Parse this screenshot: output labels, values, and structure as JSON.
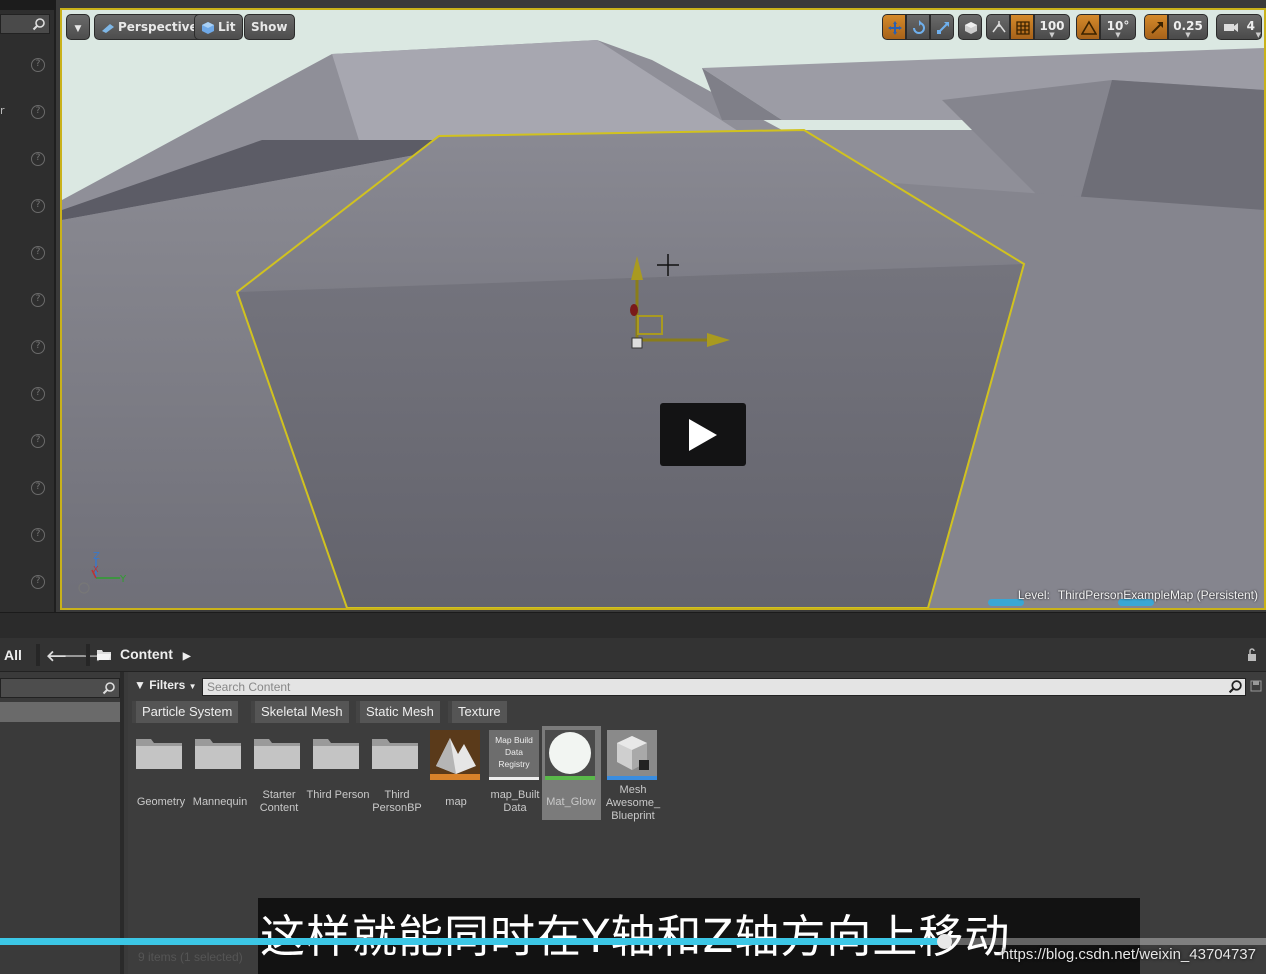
{
  "viewport": {
    "perspective_label": "Perspective",
    "lit_label": "Lit",
    "show_label": "Show",
    "grid_snap_value": "100",
    "rotation_snap_value": "10°",
    "scale_snap_value": "0.25",
    "camera_speed_value": "4",
    "level_prefix": "Level:",
    "level_name": "ThirdPersonExampleMap (Persistent)",
    "accent_selection": "#d1c21f",
    "accent_orange": "#c97b22"
  },
  "content_browser": {
    "all_label": "All",
    "path_label": "Content",
    "filters_label": "Filters",
    "search_placeholder": "Search Content",
    "filter_chips": [
      "Particle System",
      "Skeletal Mesh",
      "Static Mesh",
      "Texture"
    ],
    "assets": [
      {
        "label": "Geometry",
        "kind": "folder"
      },
      {
        "label": "Mannequin",
        "kind": "folder"
      },
      {
        "label": "Starter Content",
        "kind": "folder"
      },
      {
        "label": "Third Person",
        "kind": "folder"
      },
      {
        "label": "Third PersonBP",
        "kind": "folder"
      },
      {
        "label": "map",
        "kind": "map"
      },
      {
        "label": "map_Built Data",
        "kind": "builtdata",
        "thumb_text": "Map Build Data Registry"
      },
      {
        "label": "Mat_Glow",
        "kind": "material",
        "selected": true
      },
      {
        "label": "Mesh Awesome_ Blueprint",
        "kind": "blueprint"
      }
    ],
    "items_count": "9 items (1 selected)"
  },
  "video": {
    "subtitle": "这样就能同时在Y轴和Z轴方向上移动",
    "progress": 0.746,
    "watermark": "https://blog.csdn.net/weixin_43704737",
    "progress_color": "#3cc7e6"
  }
}
